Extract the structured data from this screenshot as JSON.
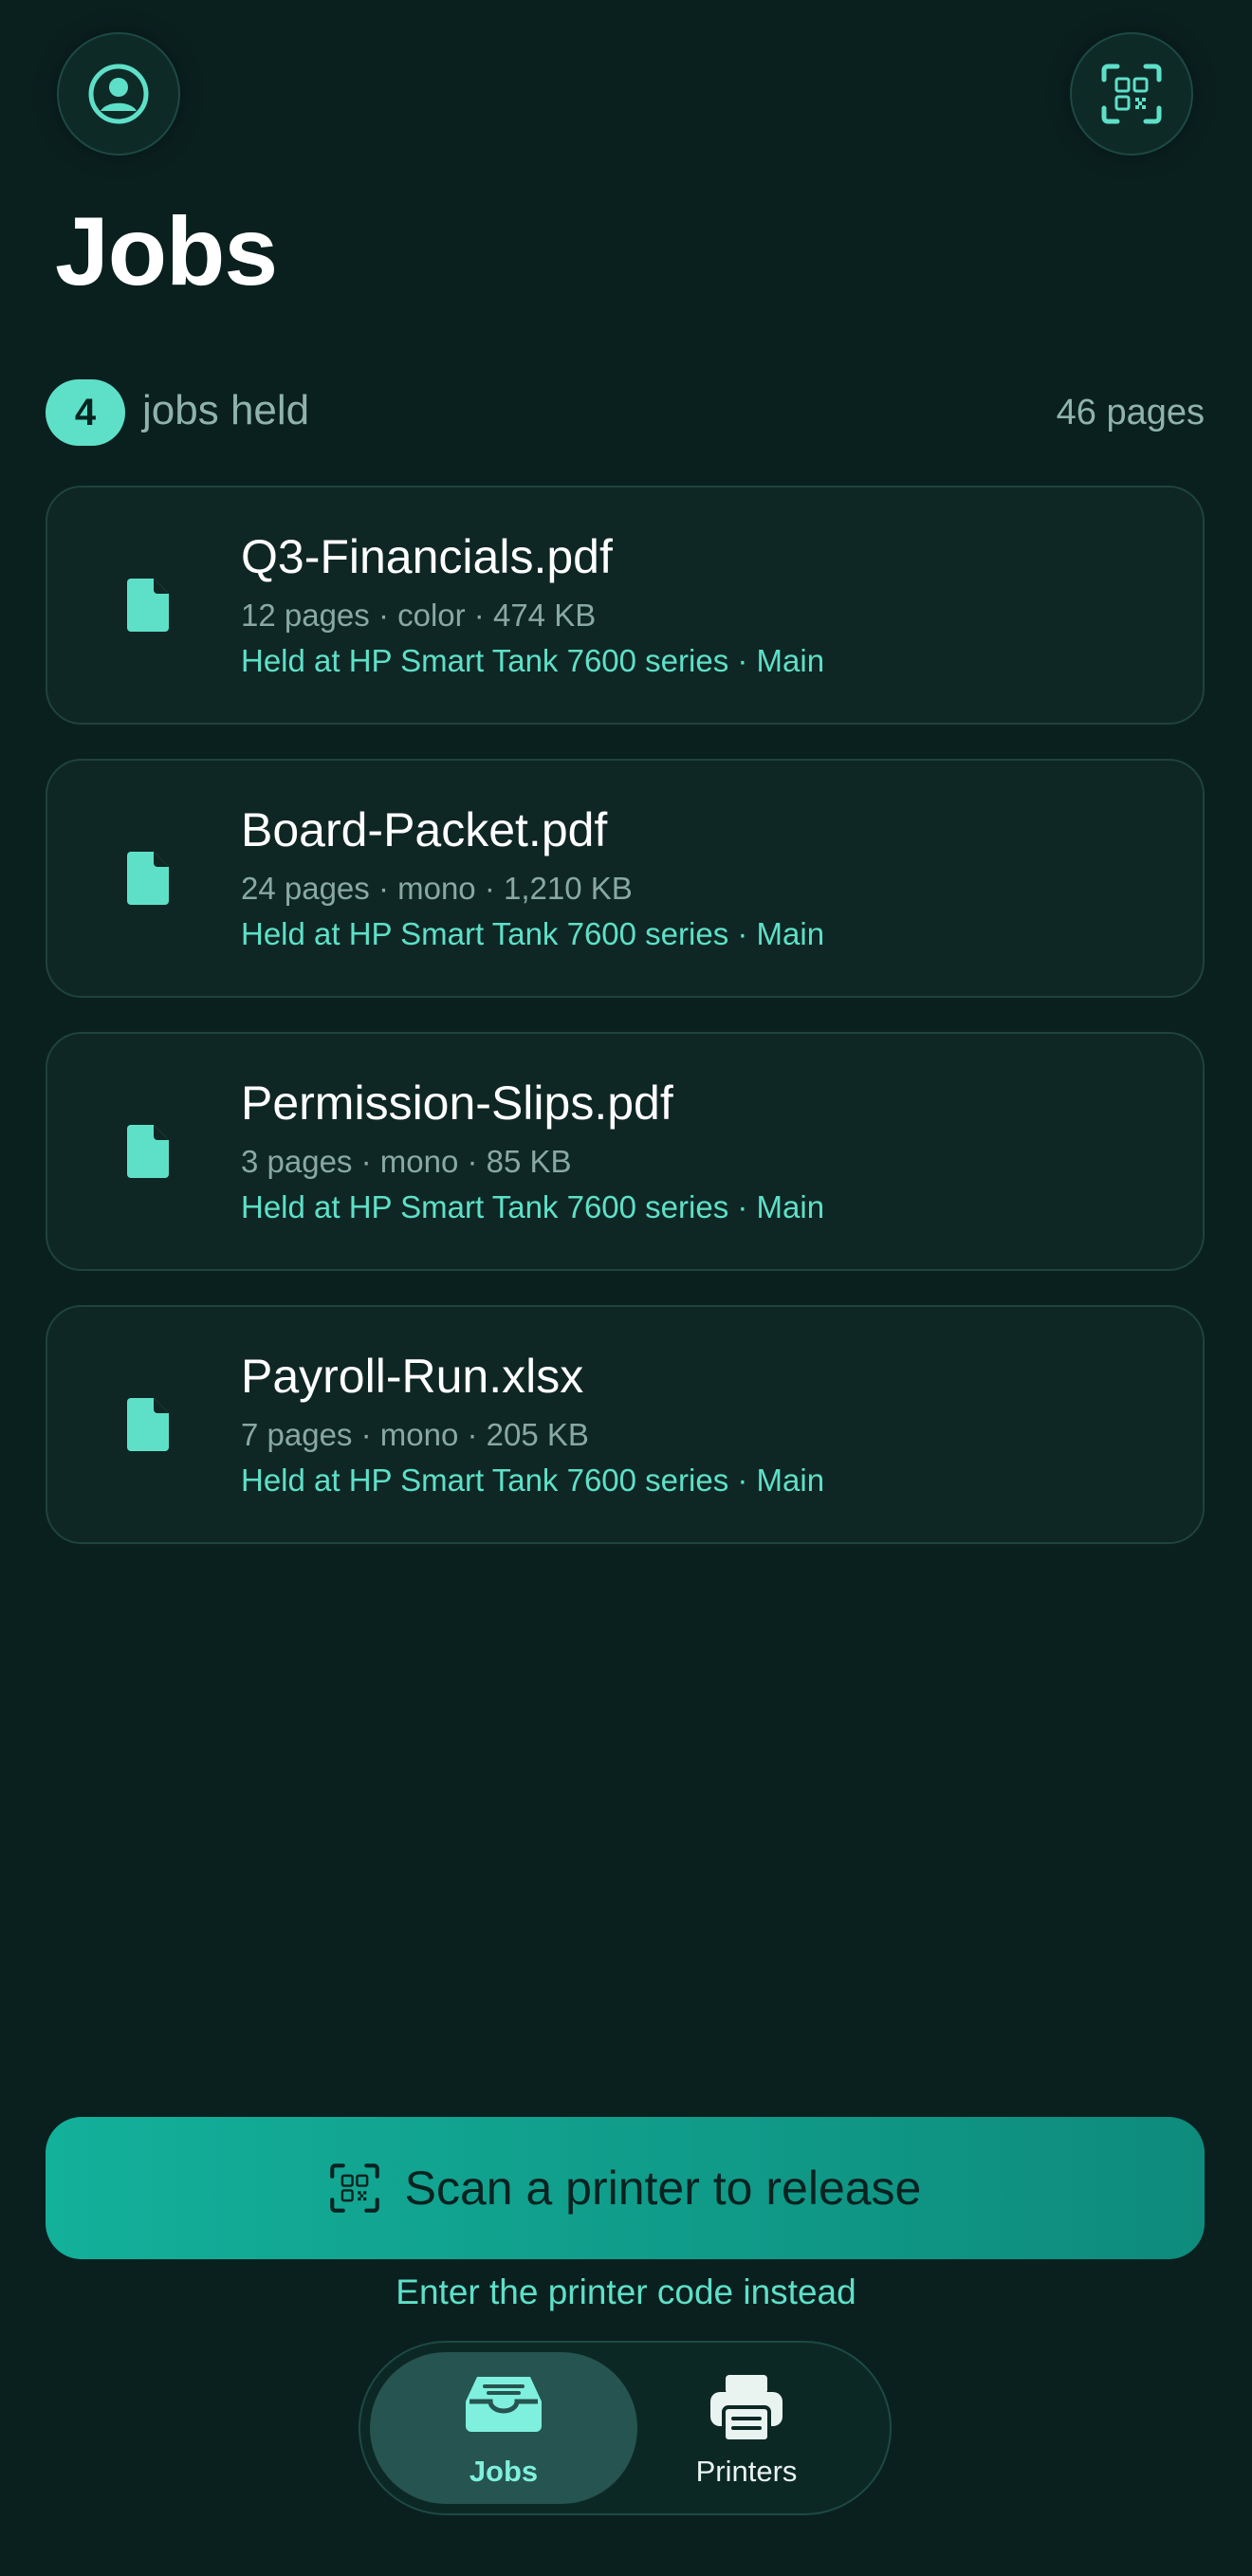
{
  "header": {
    "title": "Jobs",
    "account_icon": "user-circle-icon",
    "scan_icon": "qr-scan-icon"
  },
  "summary": {
    "count": "4",
    "count_label": "jobs held",
    "pages_total": "46 pages"
  },
  "jobs": [
    {
      "name": "Q3-Financials.pdf",
      "meta": "12 pages · color · 474 KB",
      "location": "Held at HP Smart Tank 7600 series · Main",
      "icon": "document-icon"
    },
    {
      "name": "Board-Packet.pdf",
      "meta": "24 pages · mono · 1,210 KB",
      "location": "Held at HP Smart Tank 7600 series · Main",
      "icon": "document-icon"
    },
    {
      "name": "Permission-Slips.pdf",
      "meta": "3 pages · mono · 85 KB",
      "location": "Held at HP Smart Tank 7600 series · Main",
      "icon": "document-icon"
    },
    {
      "name": "Payroll-Run.xlsx",
      "meta": "7 pages · mono · 205 KB",
      "location": "Held at HP Smart Tank 7600 series · Main",
      "icon": "document-icon"
    }
  ],
  "actions": {
    "scan_label": "Scan a printer to release",
    "enter_code_label": "Enter the printer code instead"
  },
  "tabbar": {
    "items": [
      {
        "label": "Jobs",
        "icon": "inbox-tray-icon",
        "active": true
      },
      {
        "label": "Printers",
        "icon": "printer-icon",
        "active": false
      }
    ]
  },
  "colors": {
    "background": "#0a201f",
    "accent": "#5ee0c8",
    "card": "#0f2724",
    "cta_gradient_start": "#13b09a",
    "cta_gradient_end": "#0e8b7c"
  }
}
